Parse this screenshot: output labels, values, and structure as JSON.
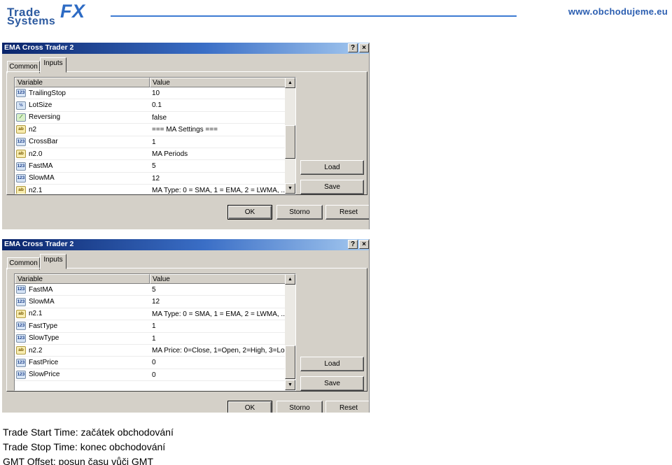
{
  "header": {
    "logo_text_1": "Trade",
    "logo_text_2": "FX",
    "logo_text_3": "Systems",
    "site_url": "www.obchodujeme.eu"
  },
  "dialogs": [
    {
      "title": "EMA Cross Trader 2",
      "help_label": "?",
      "close_label": "×",
      "tabs": [
        "Common",
        "Inputs"
      ],
      "columns": [
        "Variable",
        "Value"
      ],
      "rows": [
        {
          "icon": "123",
          "variable": "TrailingStop",
          "value": "10"
        },
        {
          "icon": "½",
          "variable": "LotSize",
          "value": "0.1"
        },
        {
          "icon": "bool",
          "variable": "Reversing",
          "value": "false"
        },
        {
          "icon": "ab",
          "variable": "n2",
          "value": "=== MA Settings ==="
        },
        {
          "icon": "123",
          "variable": "CrossBar",
          "value": "1"
        },
        {
          "icon": "ab",
          "variable": "n2.0",
          "value": "MA Periods"
        },
        {
          "icon": "123",
          "variable": "FastMA",
          "value": "5"
        },
        {
          "icon": "123",
          "variable": "SlowMA",
          "value": "12"
        },
        {
          "icon": "ab",
          "variable": "n2.1",
          "value": "MA Type: 0 = SMA, 1 = EMA, 2 = LWMA, ..."
        }
      ],
      "buttons": {
        "load": "Load",
        "save": "Save",
        "ok": "OK",
        "cancel": "Storno",
        "reset": "Reset"
      }
    },
    {
      "title": "EMA Cross Trader 2",
      "help_label": "?",
      "close_label": "×",
      "tabs": [
        "Common",
        "Inputs"
      ],
      "columns": [
        "Variable",
        "Value"
      ],
      "rows": [
        {
          "icon": "123",
          "variable": "FastMA",
          "value": "5"
        },
        {
          "icon": "123",
          "variable": "SlowMA",
          "value": "12"
        },
        {
          "icon": "ab",
          "variable": "n2.1",
          "value": "MA Type: 0 = SMA, 1 = EMA, 2 = LWMA, ..."
        },
        {
          "icon": "123",
          "variable": "FastType",
          "value": "1"
        },
        {
          "icon": "123",
          "variable": "SlowType",
          "value": "1"
        },
        {
          "icon": "ab",
          "variable": "n2.2",
          "value": "MA Price: 0=Close, 1=Open, 2=High, 3=Lo..."
        },
        {
          "icon": "123",
          "variable": "FastPrice",
          "value": "0"
        },
        {
          "icon": "123",
          "variable": "SlowPrice",
          "value": "0"
        }
      ],
      "buttons": {
        "load": "Load",
        "save": "Save",
        "ok": "OK",
        "cancel": "Storno",
        "reset": "Reset"
      }
    }
  ],
  "notes": [
    "Trade Start Time: začátek obchodování",
    "Trade Stop Time: konec obchodování",
    "GMT Offset: posun času vůči GMT"
  ],
  "colors": {
    "titlebar_start": "#0a246a",
    "titlebar_end": "#a6caf0",
    "dialog_face": "#d4d0c8",
    "brand_blue": "#2c5aa0"
  }
}
